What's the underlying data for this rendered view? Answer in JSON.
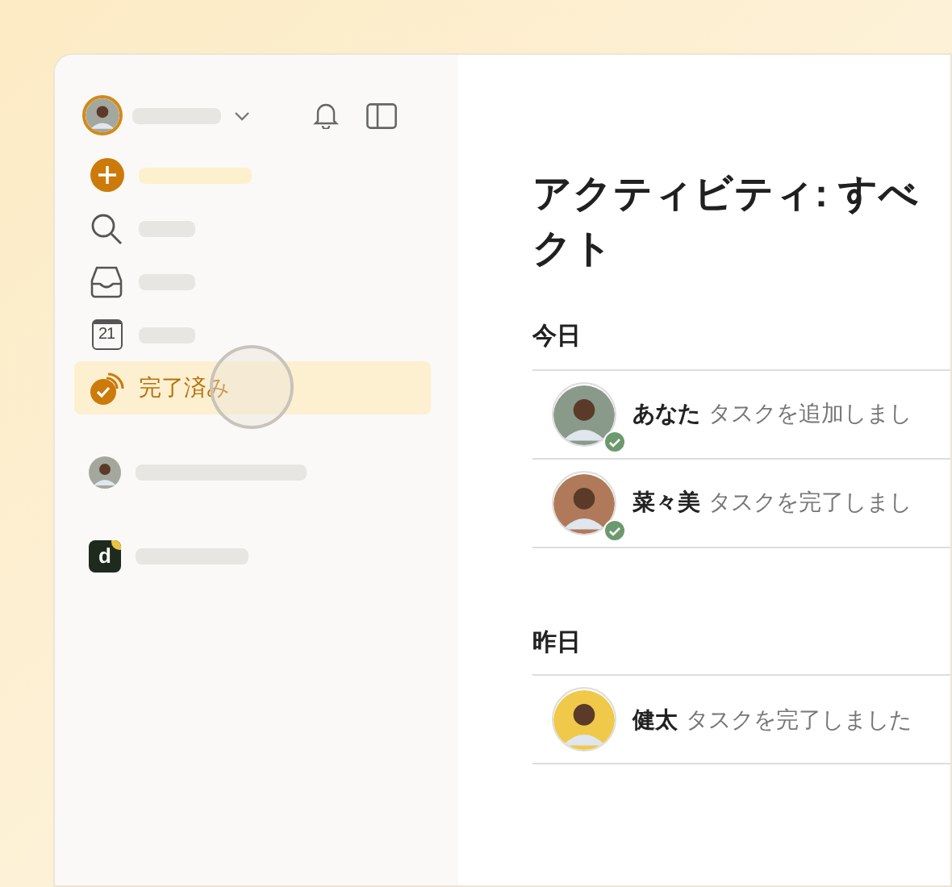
{
  "sidebar": {
    "items": [
      {
        "kind": "add",
        "selected": false
      },
      {
        "kind": "search",
        "selected": false
      },
      {
        "kind": "inbox",
        "selected": false
      },
      {
        "kind": "calendar",
        "selected": false,
        "icon_text": "21"
      },
      {
        "kind": "completed",
        "label": "完了済み",
        "selected": true
      }
    ],
    "projects": [
      {
        "kind": "person"
      },
      {
        "kind": "logo",
        "icon_text": "d"
      }
    ]
  },
  "main": {
    "title_lines": [
      "アクティビティ: すべ",
      "クト"
    ],
    "groups": [
      {
        "heading": "今日",
        "events": [
          {
            "actor": "あなた",
            "action": "タスクを追加しまし",
            "color": "#8a9a8a",
            "done_badge": true
          },
          {
            "actor": "菜々美",
            "action": "タスクを完了しまし",
            "color": "#b07a5a",
            "done_badge": true
          }
        ]
      },
      {
        "heading": "昨日",
        "events": [
          {
            "actor": "健太",
            "action": "タスクを完了しました",
            "color": "#f0c94a",
            "done_badge": false
          }
        ]
      }
    ]
  }
}
